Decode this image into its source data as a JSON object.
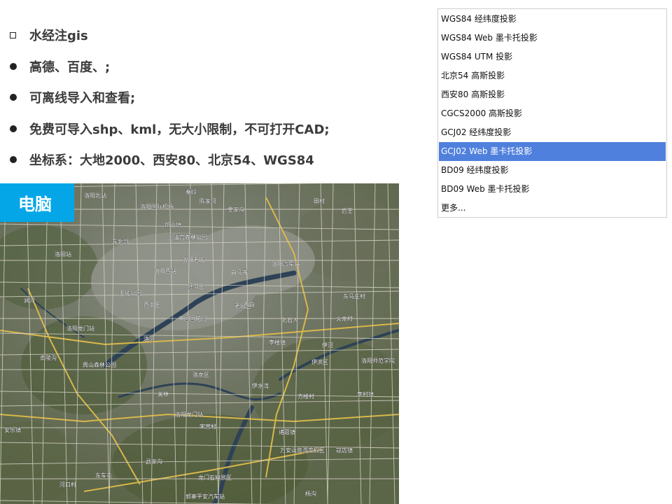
{
  "bullets": [
    {
      "marker": "square",
      "text": "水经注gis"
    },
    {
      "marker": "dot",
      "text": "高德、百度、;"
    },
    {
      "marker": "dot",
      "text": "可离线导入和查看;"
    },
    {
      "marker": "dot",
      "text": "免费可导入shp、kml，无大小限制，不可打开CAD;"
    },
    {
      "marker": "dot",
      "text": "坐标系：大地2000、西安80、北京54、WGS84"
    }
  ],
  "map": {
    "badge": "电脑",
    "labels": [
      "洛阳北站",
      "秦岭",
      "陈家河",
      "金家沟",
      "田村",
      "后王",
      "洛阳国际机场",
      "邙山镇",
      "上清宫森林公园",
      "东北部",
      "洛阳站",
      "洛阳老城",
      "洛阳西站",
      "洛阳汽车站",
      "白马寺",
      "王城公园",
      "西工区",
      "瀍河区",
      "老城区",
      "中国国花园",
      "西白",
      "北石人",
      "东马庄村",
      "火龙村",
      "洛阳龙门站",
      "李楼镇",
      "南陵沟",
      "周山森林公园",
      "洛龙区",
      "伊滨区",
      "洛阳师范学院",
      "方楼村",
      "李村镇",
      "洛阳龙门站",
      "伊水湾",
      "龙门石窟景区",
      "诸葛镇",
      "万安山旅游度假区",
      "武家沟",
      "宋营村",
      "东车屯",
      "杨沟",
      "河口村",
      "郭寨平安汽车站",
      "寇店镇",
      "安乐镇",
      "伊河",
      "洛河",
      "涧河",
      "关林"
    ]
  },
  "dropdown": {
    "options": [
      "WGS84 经纬度投影",
      "WGS84 Web 墨卡托投影",
      "WGS84 UTM 投影",
      "北京54 高斯投影",
      "西安80 高斯投影",
      "CGCS2000 高斯投影",
      "GCJ02 经纬度投影",
      "GCJ02 Web 墨卡托投影",
      "BD09 经纬度投影",
      "BD09 Web 墨卡托投影",
      "更多..."
    ],
    "selected_index": 7
  },
  "colors": {
    "badge": "#05a6e8",
    "selected": "#5080dd"
  }
}
